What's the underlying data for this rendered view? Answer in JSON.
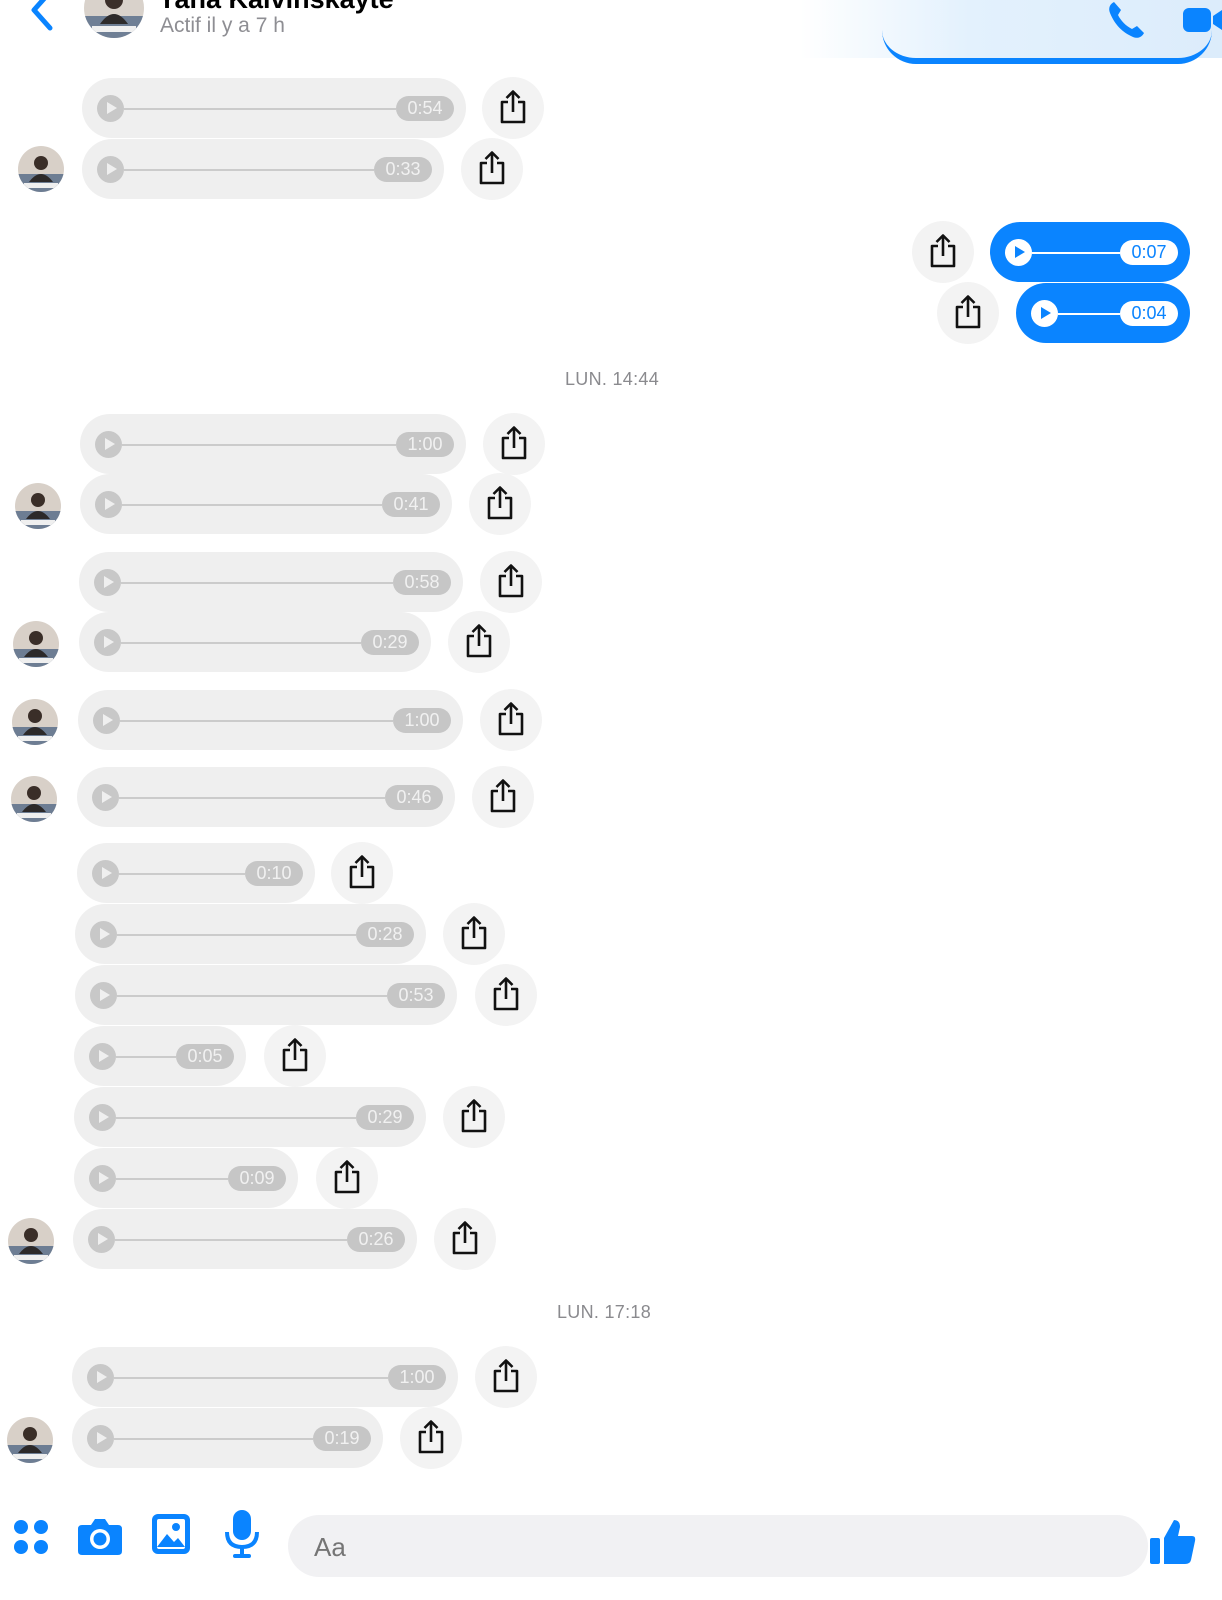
{
  "header": {
    "name": "Yana Kalvinskayte",
    "status": "Actif il y a 7 h",
    "icons": [
      "back-chevron-icon",
      "phone-icon",
      "video-camera-icon"
    ]
  },
  "timestamps": [
    "LUN. 14:44",
    "LUN. 17:18"
  ],
  "messages": [
    {
      "id": "m1",
      "from": "contact",
      "duration": "0:54"
    },
    {
      "id": "m2",
      "from": "contact",
      "duration": "0:33"
    },
    {
      "id": "m3",
      "from": "me",
      "duration": "0:07"
    },
    {
      "id": "m4",
      "from": "me",
      "duration": "0:04"
    },
    {
      "id": "m5",
      "from": "contact",
      "duration": "1:00"
    },
    {
      "id": "m6",
      "from": "contact",
      "duration": "0:41"
    },
    {
      "id": "m7",
      "from": "contact",
      "duration": "0:58"
    },
    {
      "id": "m8",
      "from": "contact",
      "duration": "0:29"
    },
    {
      "id": "m9",
      "from": "contact",
      "duration": "1:00"
    },
    {
      "id": "m10",
      "from": "contact",
      "duration": "0:46"
    },
    {
      "id": "m11",
      "from": "contact",
      "duration": "0:10"
    },
    {
      "id": "m12",
      "from": "contact",
      "duration": "0:28"
    },
    {
      "id": "m13",
      "from": "contact",
      "duration": "0:53"
    },
    {
      "id": "m14",
      "from": "contact",
      "duration": "0:05"
    },
    {
      "id": "m15",
      "from": "contact",
      "duration": "0:29"
    },
    {
      "id": "m16",
      "from": "contact",
      "duration": "0:09"
    },
    {
      "id": "m17",
      "from": "contact",
      "duration": "0:26"
    },
    {
      "id": "m18",
      "from": "contact",
      "duration": "1:00"
    },
    {
      "id": "m19",
      "from": "contact",
      "duration": "0:19"
    }
  ],
  "composer": {
    "placeholder": "Aa",
    "icons": [
      "apps-grid-icon",
      "camera-icon",
      "photo-gallery-icon",
      "microphone-icon",
      "emoji-icon",
      "thumbs-up-icon"
    ]
  },
  "colors": {
    "accent": "#0a84ff",
    "received_bubble": "#efefef",
    "share_button": "#f3f3f3",
    "timestamp_text": "#8a8a8e"
  }
}
